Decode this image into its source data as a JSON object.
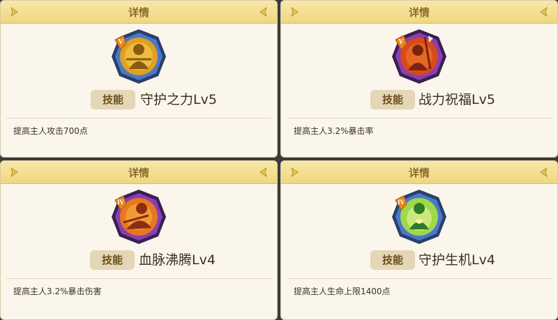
{
  "cards": [
    {
      "header_title": "详情",
      "tag_label": "技能",
      "skill_name": "守护之力Lv5",
      "description": "提高主人攻击700点",
      "rank_numeral": "V",
      "ring_color": "#4a78c9",
      "inner_color": "#e0a020",
      "figure_color": "#8a5a10"
    },
    {
      "header_title": "详情",
      "tag_label": "技能",
      "skill_name": "战力祝福Lv5",
      "description": "提高主人3.2%暴击率",
      "rank_numeral": "V",
      "ring_color": "#8a3fb0",
      "inner_color": "#d84a1c",
      "figure_color": "#7a2410"
    },
    {
      "header_title": "详情",
      "tag_label": "技能",
      "skill_name": "血脉沸腾Lv4",
      "description": "提高主人3.2%暴击伤害",
      "rank_numeral": "IV",
      "ring_color": "#8a3fb0",
      "inner_color": "#e8781e",
      "figure_color": "#8a2e10"
    },
    {
      "header_title": "详情",
      "tag_label": "技能",
      "skill_name": "守护生机Lv4",
      "description": "提高主人生命上限1400点",
      "rank_numeral": "IV",
      "ring_color": "#4a78c9",
      "inner_color": "#9fd84a",
      "figure_color": "#2f7a2a"
    }
  ]
}
